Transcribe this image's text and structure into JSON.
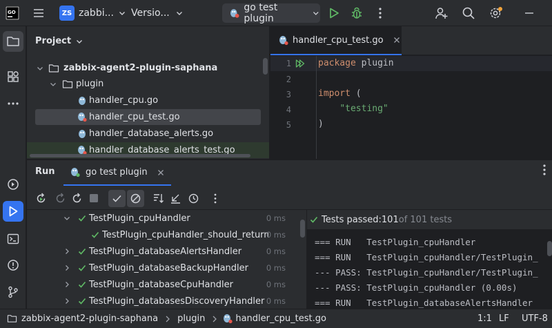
{
  "titlebar": {
    "project_badge": "ZS",
    "project_name": "zabbi...",
    "vcs_label": "Versio...",
    "run_config": "go test plugin"
  },
  "project_panel": {
    "title": "Project",
    "tree": [
      {
        "label": "zabbix-agent2-plugin-saphana",
        "type": "folder",
        "expanded": true
      },
      {
        "label": "plugin",
        "type": "folder",
        "expanded": true
      },
      {
        "label": "handler_cpu.go",
        "type": "go-file"
      },
      {
        "label": "handler_cpu_test.go",
        "type": "go-test-file",
        "selected": true
      },
      {
        "label": "handler_database_alerts.go",
        "type": "go-file"
      },
      {
        "label": "handler_database_alerts_test.go",
        "type": "go-test-file"
      }
    ]
  },
  "editor": {
    "tab_label": "handler_cpu_test.go",
    "lines": [
      {
        "num": "1",
        "tokens": [
          {
            "t": "package",
            "c": "kw"
          },
          {
            "t": " plugin",
            "c": "plain"
          }
        ]
      },
      {
        "num": "2",
        "tokens": []
      },
      {
        "num": "3",
        "tokens": [
          {
            "t": "import",
            "c": "kw"
          },
          {
            "t": " (",
            "c": "plain"
          }
        ]
      },
      {
        "num": "4",
        "tokens": [
          {
            "t": "    ",
            "c": "plain"
          },
          {
            "t": "\"testing\"",
            "c": "str"
          }
        ]
      },
      {
        "num": "5",
        "tokens": [
          {
            "t": ")",
            "c": "plain"
          }
        ]
      }
    ]
  },
  "run_panel": {
    "title": "Run",
    "tab_label": "go test plugin",
    "tests": [
      {
        "name": "TestPlugin_cpuHandler",
        "time": "0 ms",
        "expanded": true,
        "level": 1
      },
      {
        "name": "TestPlugin_cpuHandler_should_return_",
        "time": "0 ms",
        "level": 2
      },
      {
        "name": "TestPlugin_databaseAlertsHandler",
        "time": "0 ms",
        "level": 1
      },
      {
        "name": "TestPlugin_databaseBackupHandler",
        "time": "0 ms",
        "level": 1
      },
      {
        "name": "TestPlugin_databaseCpuHandler",
        "time": "0 ms",
        "level": 1
      },
      {
        "name": "TestPlugin_databasesDiscoveryHandler",
        "time": "0 ms",
        "level": 1
      }
    ],
    "result_prefix": "Tests passed: ",
    "result_passed": "101",
    "result_suffix": " of 101 tests",
    "console": [
      "=== RUN   TestPlugin_cpuHandler",
      "=== RUN   TestPlugin_cpuHandler/TestPlugin_",
      "--- PASS: TestPlugin_cpuHandler/TestPlugin_",
      "--- PASS: TestPlugin_cpuHandler (0.00s)",
      "=== RUN   TestPlugin_databaseAlertsHandler"
    ]
  },
  "statusbar": {
    "crumb_project": "zabbix-agent2-plugin-saphana",
    "crumb_folder": "plugin",
    "crumb_file": "handler_cpu_test.go",
    "position": "1:1",
    "line_sep": "LF",
    "encoding": "UTF-8"
  },
  "colors": {
    "accent": "#3574f0",
    "pass_green": "#5fb865",
    "keyword": "#cf8e6d",
    "string": "#6aab73"
  }
}
